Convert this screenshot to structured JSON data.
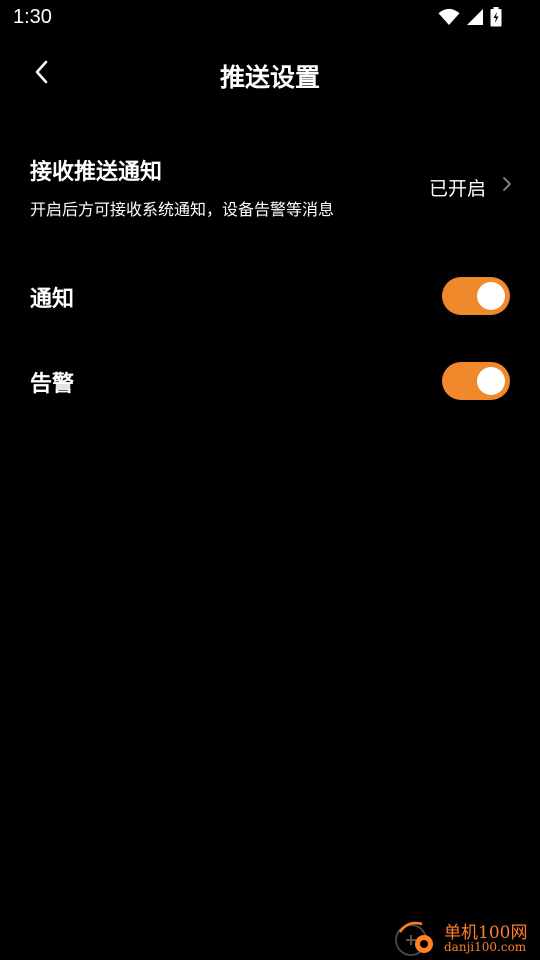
{
  "status_bar": {
    "time": "1:30",
    "icons": [
      "wifi-icon",
      "cellular-signal-icon",
      "battery-charging-icon"
    ]
  },
  "header": {
    "back_icon": "chevron-left-icon",
    "title": "推送设置"
  },
  "push": {
    "title": "接收推送通知",
    "description": "开启后方可接收系统通知，设备告警等消息",
    "status": "已开启",
    "chevron_icon": "chevron-right-icon"
  },
  "toggles": [
    {
      "label": "通知",
      "on": true
    },
    {
      "label": "告警",
      "on": true
    }
  ],
  "colors": {
    "background": "#000000",
    "accent": "#F0892B",
    "text": "#FFFFFF",
    "chevron": "#8A8A8A"
  },
  "watermark": {
    "line1": "单机100网",
    "line2": "danji100.com"
  }
}
